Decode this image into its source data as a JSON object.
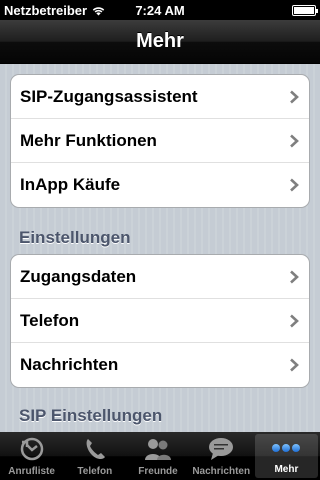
{
  "status": {
    "carrier": "Netzbetreiber",
    "time": "7:24 AM",
    "battery_level": 1.0
  },
  "navbar": {
    "title": "Mehr"
  },
  "group1": {
    "items": [
      {
        "label": "SIP-Zugangsassistent"
      },
      {
        "label": "Mehr Funktionen"
      },
      {
        "label": "InApp Käufe"
      }
    ]
  },
  "section_einstellungen": {
    "title": "Einstellungen"
  },
  "group2": {
    "items": [
      {
        "label": "Zugangsdaten"
      },
      {
        "label": "Telefon"
      },
      {
        "label": "Nachrichten"
      }
    ]
  },
  "section_sip": {
    "title": "SIP Einstellungen"
  },
  "tabbar": {
    "tabs": [
      {
        "label": "Anrufliste",
        "icon": "call-log-icon",
        "active": false
      },
      {
        "label": "Telefon",
        "icon": "phone-icon",
        "active": false
      },
      {
        "label": "Freunde",
        "icon": "contacts-icon",
        "active": false
      },
      {
        "label": "Nachrichten",
        "icon": "messages-icon",
        "active": false
      },
      {
        "label": "Mehr",
        "icon": "more-icon",
        "active": true
      }
    ]
  },
  "colors": {
    "accent_blue": "#1f6fd6",
    "section_text": "#4c566c",
    "background": "#c5ccd4"
  }
}
